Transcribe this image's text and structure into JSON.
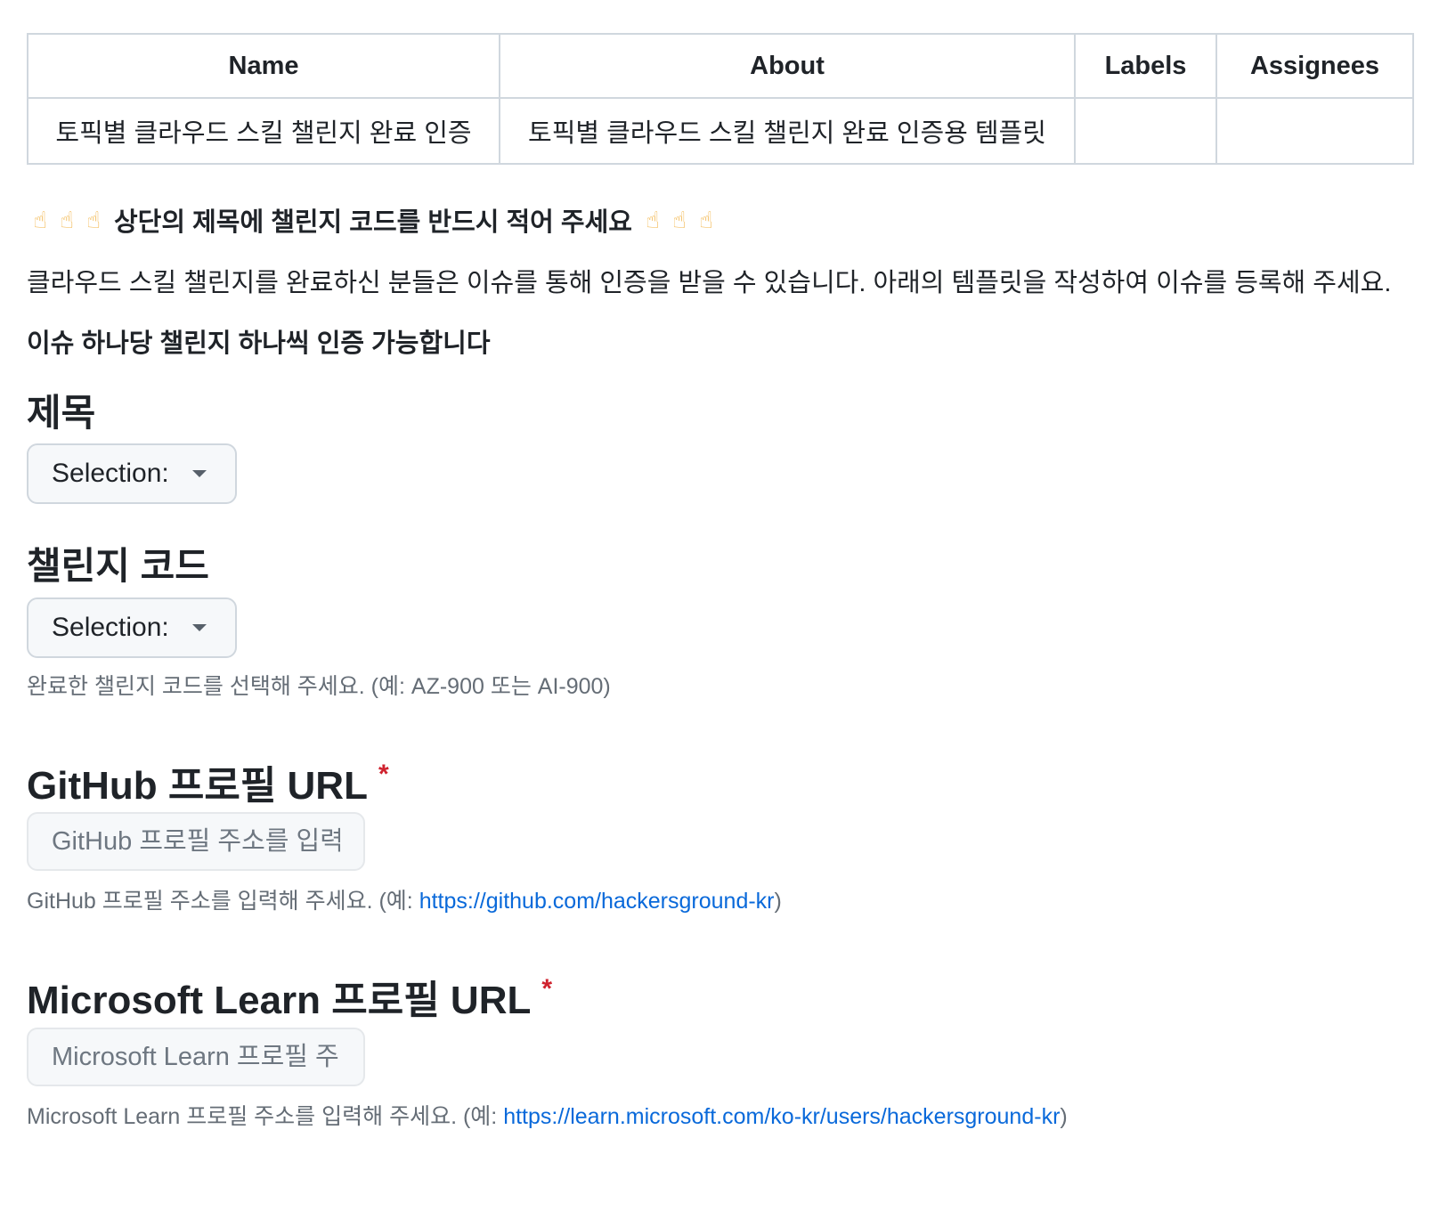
{
  "metadata_table": {
    "headers": [
      "Name",
      "About",
      "Labels",
      "Assignees"
    ],
    "row": [
      "토픽별 클라우드 스킬 챌린지 완료 인증",
      "토픽별 클라우드 스킬 챌린지 완료 인증용 템플릿",
      "",
      ""
    ]
  },
  "intro": {
    "notice": "상단의 제목에 챌린지 코드를 반드시 적어 주세요",
    "pointer_icon": "pointing-up-emoji",
    "description": "클라우드 스킬 챌린지를 완료하신 분들은 이슈를 통해 인증을 받을 수 있습니다. 아래의 템플릿을 작성하여 이슈를 등록해 주세요.",
    "one_per_issue": "이슈 하나당 챌린지 하나씩 인증 가능합니다"
  },
  "fields": {
    "title": {
      "label": "제목",
      "select_label": "Selection:"
    },
    "challenge_code": {
      "label": "챌린지 코드",
      "select_label": "Selection:",
      "hint": "완료한 챌린지 코드를 선택해 주세요. (예: AZ-900 또는 AI-900)"
    },
    "github_url": {
      "label": "GitHub 프로필 URL",
      "required_mark": "*",
      "placeholder": "GitHub 프로필 주소를 입력",
      "hint_prefix": "GitHub 프로필 주소를 입력해 주세요. (예: ",
      "hint_link": "https://github.com/hackersground-kr",
      "hint_suffix": ")"
    },
    "ms_learn_url": {
      "label": "Microsoft Learn 프로필 URL",
      "required_mark": "*",
      "placeholder": "Microsoft Learn 프로필 주소를 입력",
      "hint_prefix": "Microsoft Learn 프로필 주소를 입력해 주세요. (예: ",
      "hint_link": "https://learn.microsoft.com/ko-kr/users/hackersground-kr",
      "hint_suffix": ")"
    }
  },
  "colors": {
    "text": "#1f2328",
    "muted": "#656d76",
    "link": "#0969da",
    "required": "#cf222e",
    "border": "#d0d7de",
    "input_bg": "#f6f8fa"
  }
}
